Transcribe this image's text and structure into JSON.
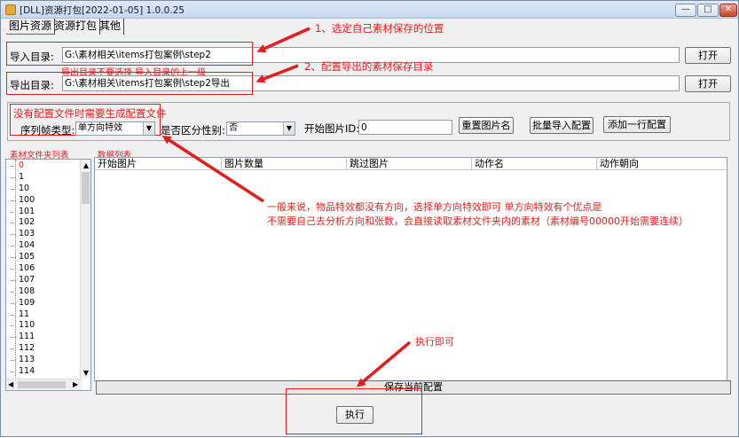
{
  "window": {
    "title": "[DLL]资源打包[2022-01-05] 1.0.0.25",
    "minimize": "—",
    "maximize": "□",
    "close": "✕"
  },
  "menu": {
    "tabs": [
      {
        "label": "图片资源"
      },
      {
        "label": "资源打包"
      },
      {
        "label": "其他"
      }
    ]
  },
  "import": {
    "label": "导入目录:",
    "value": "G:\\素材相关\\items打包案例\\step2",
    "open_button": "打开"
  },
  "export": {
    "label": "导出目录:",
    "value": "G:\\素材相关\\items打包案例\\step2导出",
    "open_button": "打开",
    "hint": "导出目录不要选择 导入目录的上一级"
  },
  "config": {
    "notice": "没有配置文件时需要生成配置文件",
    "seq_type_label": "序列帧类型:",
    "seq_type_value": "单方向特效",
    "gender_label": "是否区分性别:",
    "gender_value": "否",
    "start_id_label": "开始图片ID:",
    "start_id_value": "0",
    "rename_button": "重置图片名",
    "batch_import_button": "批量导入配置",
    "add_row_button": "添加一行配置"
  },
  "folder_list": {
    "title": "素材文件夹列表",
    "items": [
      "0",
      "1",
      "10",
      "100",
      "101",
      "102",
      "103",
      "104",
      "105",
      "106",
      "107",
      "108",
      "109",
      "11",
      "110",
      "111",
      "112",
      "113",
      "114"
    ]
  },
  "data_list": {
    "title": "数据列表",
    "columns": [
      "开始图片",
      "图片数量",
      "跳过图片",
      "动作名",
      "动作朝向"
    ]
  },
  "save_config_button": "保存当前配置",
  "execute_button": "执行",
  "annotations": {
    "a1": "1、选定自己素材保存的位置",
    "a2": "2、配置导出的素材保存目录",
    "a3_line1": "一般来说，物品特效都没有方向，选择单方向特效即可 单方向特效有个优点是",
    "a3_line2": "不需要自己去分析方向和张数，会直接读取素材文件夹内的素材（素材编号00000开始需要连续）",
    "a4": "执行即可"
  },
  "colors": {
    "annotation": "#e02020",
    "window_frame": "#7a8ca4"
  }
}
